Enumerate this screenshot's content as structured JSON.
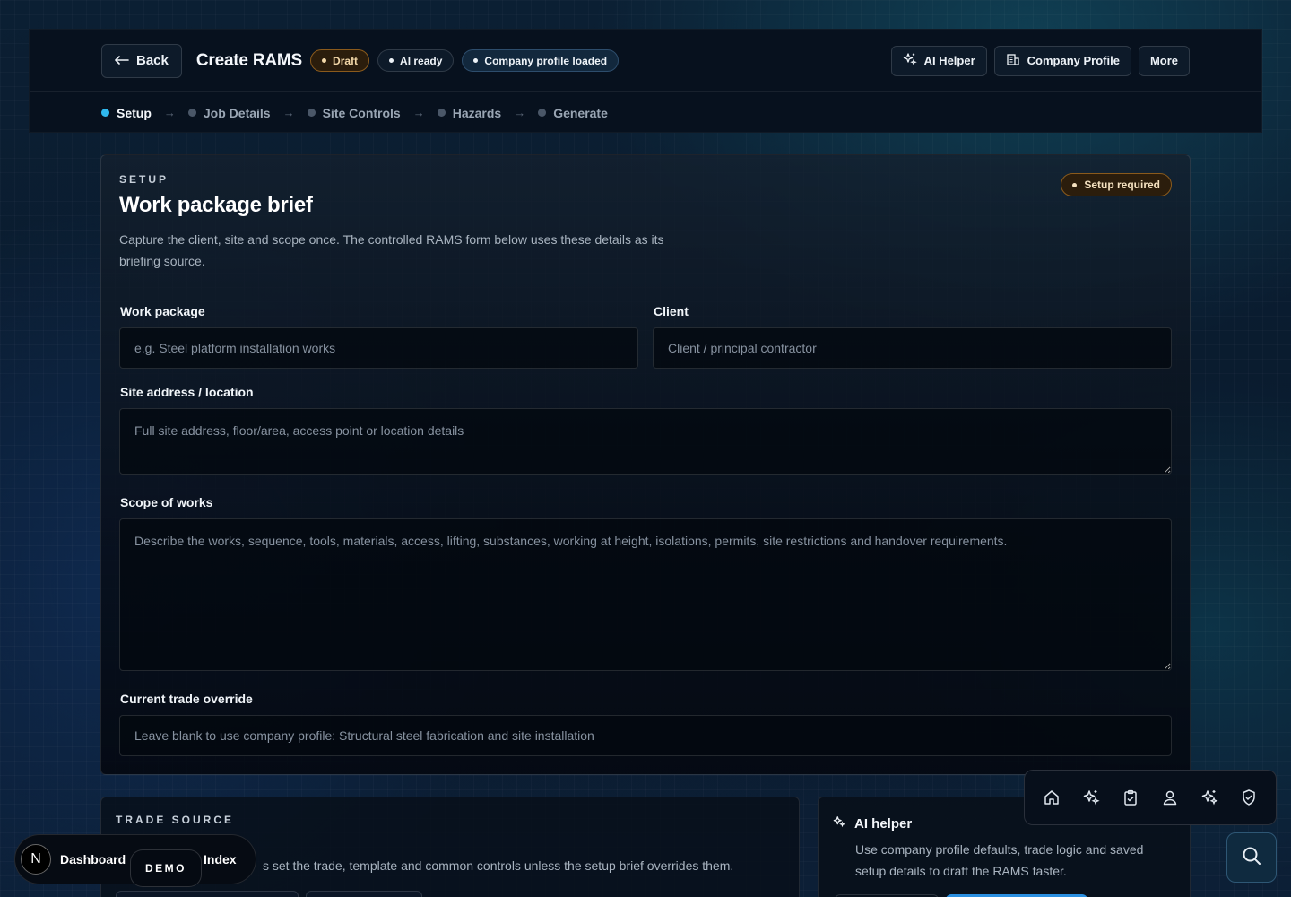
{
  "header": {
    "back_label": "Back",
    "title": "Create RAMS",
    "pills": [
      "Draft",
      "AI ready",
      "Company profile loaded"
    ],
    "actions": {
      "ai_helper": "AI Helper",
      "company_profile": "Company Profile",
      "more": "More"
    }
  },
  "steps": [
    "Setup",
    "Job Details",
    "Site Controls",
    "Hazards",
    "Generate"
  ],
  "setup": {
    "eyebrow": "SETUP",
    "title": "Work package brief",
    "description": "Capture the client, site and scope once. The controlled RAMS form below uses these details as its briefing source.",
    "badge": "Setup required",
    "fields": {
      "work_package": {
        "label": "Work package",
        "placeholder": "e.g. Steel platform installation works",
        "value": ""
      },
      "client": {
        "label": "Client",
        "placeholder": "Client / principal contractor",
        "value": ""
      },
      "site": {
        "label": "Site address / location",
        "placeholder": "Full site address, floor/area, access point or location details",
        "value": ""
      },
      "scope": {
        "label": "Scope of works",
        "placeholder": "Describe the works, sequence, tools, materials, access, lifting, substances, working at height, isolations, permits, site restrictions and handover requirements.",
        "value": ""
      },
      "trade": {
        "label": "Current trade override",
        "placeholder": "Leave blank to use company profile: Structural steel fabrication and site installation",
        "value": ""
      }
    }
  },
  "trade_source": {
    "eyebrow": "TRADE SOURCE",
    "text": "s set the trade, template and common controls unless the setup brief overrides them."
  },
  "ai_helper": {
    "title": "AI helper",
    "description": "Use company profile defaults, trade logic and saved setup details to draft the RAMS faster."
  },
  "devbar": {
    "logo": "N",
    "dashboard": "Dashboard",
    "demo": "DEMO",
    "index": "Index"
  },
  "colors": {
    "accent": "#2fb8ee",
    "draft": "#8a5a1c",
    "primary_button": "#2a8fe0"
  },
  "icons": [
    "home-icon",
    "sparkles-icon",
    "clipboard-check-icon",
    "user-pin-icon",
    "sparkles-icon",
    "shield-check-icon",
    "search-icon"
  ]
}
